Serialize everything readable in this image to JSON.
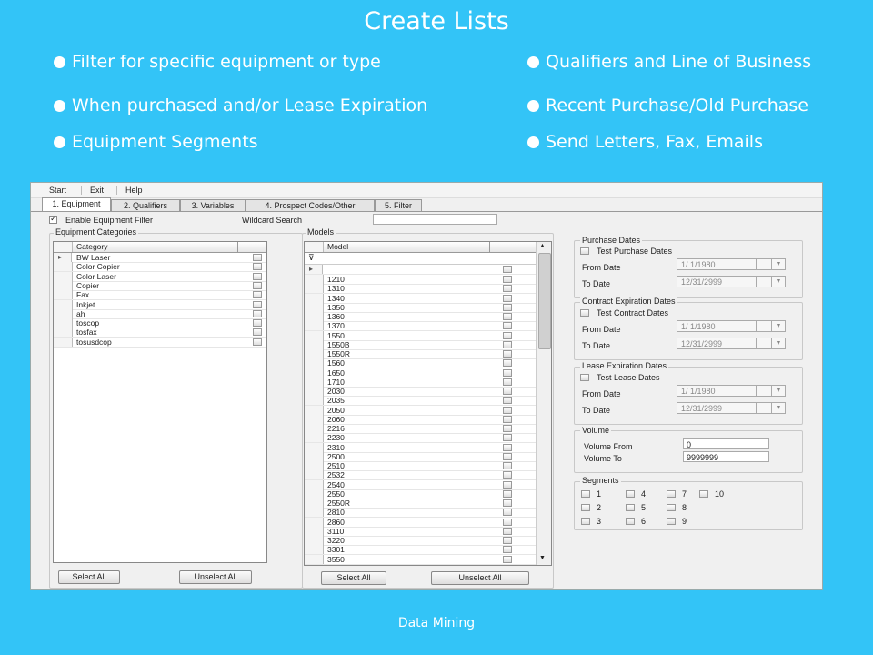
{
  "slide": {
    "title": "Create Lists",
    "bullets_left": [
      "Filter for specific equipment or type",
      "When purchased and/or Lease Expiration",
      "Equipment Segments"
    ],
    "bullets_right": [
      "Qualifiers and Line of Business",
      "Recent Purchase/Old Purchase",
      "Send Letters, Fax, Emails"
    ],
    "footer": "Data Mining"
  },
  "app": {
    "menu": [
      "Start",
      "Exit",
      "Help"
    ],
    "tabs": [
      "1. Equipment",
      "2. Qualifiers",
      "3. Variables",
      "4. Prospect Codes/Other",
      "5. Filter"
    ],
    "enable_filter_label": "Enable Equipment Filter",
    "enable_filter_checked": true,
    "wildcard_label": "Wildcard Search",
    "wildcard_value": "",
    "categories": {
      "group_label": "Equipment Categories",
      "column": "Category",
      "rows": [
        "BW Laser",
        "Color Copier",
        "Color Laser",
        "Copier",
        "Fax",
        "Inkjet",
        "ah",
        "toscop",
        "tosfax",
        "tosusdcop"
      ]
    },
    "models": {
      "group_label": "Models",
      "column": "Model",
      "rows": [
        "1210",
        "1310",
        "1340",
        "1350",
        "1360",
        "1370",
        "1550",
        "1550B",
        "1550R",
        "1560",
        "1650",
        "1710",
        "2030",
        "2035",
        "2050",
        "2060",
        "2216",
        "2230",
        "2310",
        "2500",
        "2510",
        "2532",
        "2540",
        "2550",
        "2550R",
        "2810",
        "2860",
        "3110",
        "3220",
        "3301",
        "3550"
      ]
    },
    "buttons": {
      "select_all": "Select All",
      "unselect_all": "Unselect All"
    },
    "date_groups": [
      {
        "title": "Purchase Dates",
        "check_label": "Test Purchase Dates",
        "from_label": "From Date",
        "from_value": "1/ 1/1980",
        "to_label": "To Date",
        "to_value": "12/31/2999"
      },
      {
        "title": "Contract Expiration Dates",
        "check_label": "Test Contract Dates",
        "from_label": "From Date",
        "from_value": "1/ 1/1980",
        "to_label": "To Date",
        "to_value": "12/31/2999"
      },
      {
        "title": "Lease Expiration Dates",
        "check_label": "Test Lease Dates",
        "from_label": "From Date",
        "from_value": "1/ 1/1980",
        "to_label": "To Date",
        "to_value": "12/31/2999"
      }
    ],
    "volume": {
      "title": "Volume",
      "from_label": "Volume From",
      "from_value": "0",
      "to_label": "Volume To",
      "to_value": "9999999"
    },
    "segments": {
      "title": "Segments",
      "items": [
        "1",
        "2",
        "3",
        "4",
        "5",
        "6",
        "7",
        "8",
        "9",
        "10"
      ]
    }
  }
}
